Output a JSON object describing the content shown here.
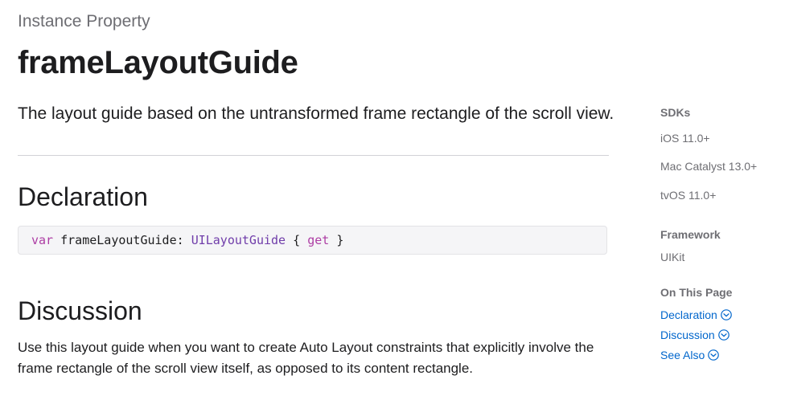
{
  "header": {
    "eyebrow": "Instance Property",
    "title": "frameLayoutGuide",
    "abstract": "The layout guide based on the untransformed frame rectangle of the scroll view."
  },
  "declaration": {
    "heading": "Declaration",
    "code": {
      "kw_var": "var",
      "name": "frameLayoutGuide:",
      "type": "UILayoutGuide",
      "open": "{",
      "kw_get": "get",
      "close": "}"
    }
  },
  "discussion": {
    "heading": "Discussion",
    "text": "Use this layout guide when you want to create Auto Layout constraints that explicitly involve the frame rectangle of the scroll view itself, as opposed to its content rectangle."
  },
  "sidebar": {
    "sdks_heading": "SDKs",
    "sdks": [
      "iOS 11.0+",
      "Mac Catalyst 13.0+",
      "tvOS 11.0+"
    ],
    "framework_heading": "Framework",
    "framework": "UIKit",
    "on_this_page_heading": "On This Page",
    "links": [
      "Declaration",
      "Discussion",
      "See Also"
    ]
  },
  "colors": {
    "link": "#0066cc",
    "keyword": "#ad3da4",
    "type": "#703daa",
    "muted": "#6e6e73"
  },
  "icons": {
    "link_chevron": "chevron-down-circle-icon"
  }
}
